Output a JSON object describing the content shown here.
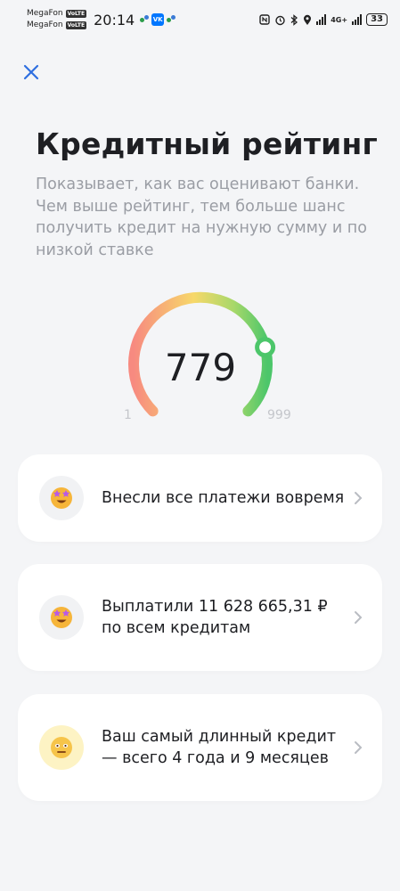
{
  "status_bar": {
    "carrier1": "MegaFon",
    "carrier2": "MegaFon",
    "volte": "VoLTE",
    "time": "20:14",
    "vk_label": "VK",
    "net": "4G+",
    "battery": "33"
  },
  "header": {
    "close_icon": "close-icon"
  },
  "main": {
    "title": "Кредитный рейтинг",
    "subtitle": "Показывает, как вас оценивают банки. Чем выше рейтинг, тем больше шанс получить кредит на нужную сумму и по низкой ставке"
  },
  "gauge": {
    "score": "779",
    "min": "1",
    "max": "999",
    "level": 0.78,
    "colors": [
      "#f78a80",
      "#f7d86a",
      "#4cc66a"
    ]
  },
  "cards": [
    {
      "text": "Внесли все платежи вовремя",
      "icon": "star-eyes-emoji-icon"
    },
    {
      "text": "Выплатили 11 628 665,31 ₽ по всем кредитам",
      "icon": "star-eyes-emoji-icon"
    },
    {
      "text": "Ваш самый длинный кредит — всего 4 года и 9 месяцев",
      "icon": "neutral-face-emoji-icon"
    }
  ],
  "colors": {
    "accent": "#2f6fe0",
    "background": "#f4f5f7",
    "card": "#ffffff",
    "muted_text": "#9a9da4"
  }
}
